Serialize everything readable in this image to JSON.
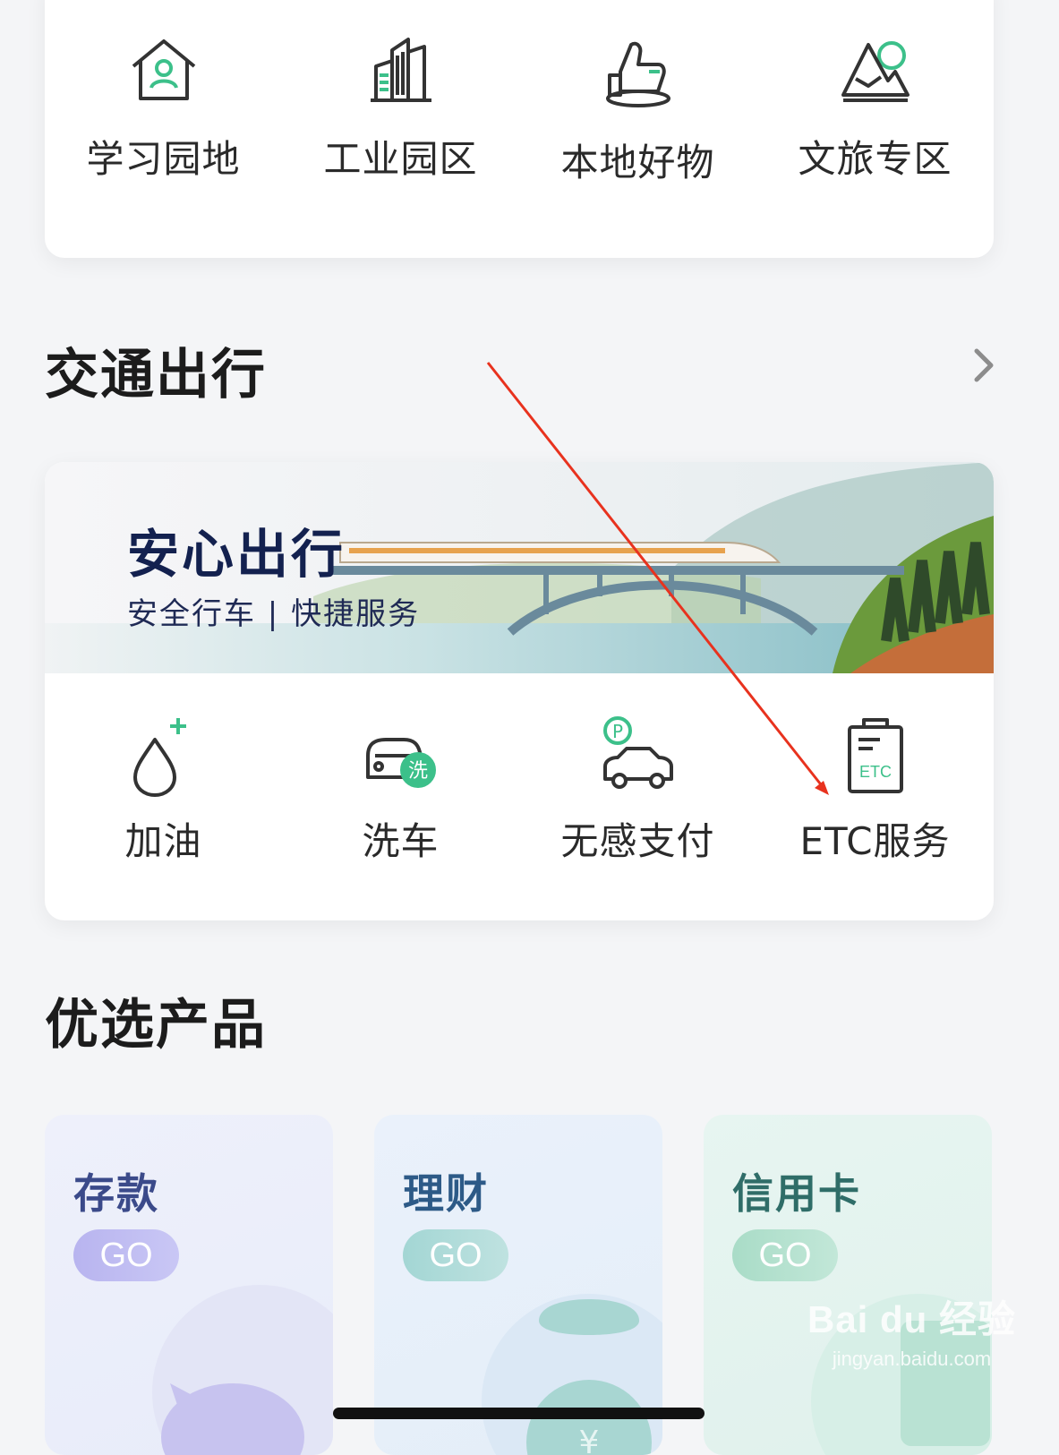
{
  "top_grid": {
    "items": [
      {
        "label": "学习园地",
        "icon": "house-person-icon"
      },
      {
        "label": "工业园区",
        "icon": "buildings-icon"
      },
      {
        "label": "本地好物",
        "icon": "thumbs-up-icon"
      },
      {
        "label": "文旅专区",
        "icon": "mountain-sun-icon"
      }
    ]
  },
  "transport": {
    "title": "交通出行",
    "banner_title": "安心出行",
    "banner_subtitle": "安全行车 | 快捷服务",
    "items": [
      {
        "label": "加油",
        "icon": "fuel-drop-icon"
      },
      {
        "label": "洗车",
        "icon": "car-wash-icon"
      },
      {
        "label": "无感支付",
        "icon": "parking-car-icon"
      },
      {
        "label": "ETC服务",
        "icon": "etc-clipboard-icon"
      }
    ]
  },
  "products": {
    "title": "优选产品",
    "items": [
      {
        "title": "存款",
        "go": "GO"
      },
      {
        "title": "理财",
        "go": "GO"
      },
      {
        "title": "信用卡",
        "go": "GO"
      }
    ]
  },
  "watermark": {
    "brand": "Bai du 经验",
    "url": "jingyan.baidu.com"
  },
  "colors": {
    "accent_green": "#3cc08a",
    "icon_stroke": "#333333",
    "annotation_red": "#e8321e"
  }
}
